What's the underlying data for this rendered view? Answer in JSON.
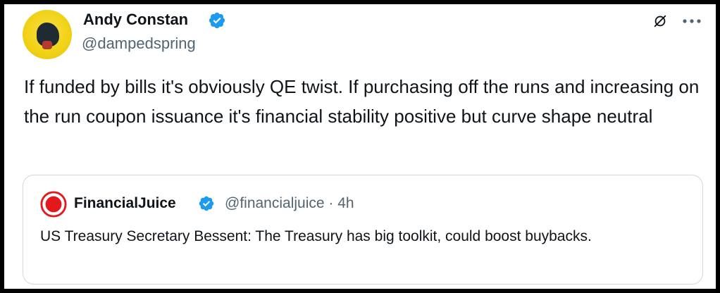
{
  "author": {
    "name": "Andy Constan",
    "handle": "@dampedspring",
    "verified": true
  },
  "tweet": {
    "text": "If funded by bills it's obviously QE twist.  If purchasing off the runs and increasing on the run coupon issuance it's financial stability positive but curve shape neutral"
  },
  "quoted_tweet": {
    "name": "FinancialJuice",
    "handle": "@financialjuice",
    "separator": "·",
    "time": "4h",
    "verified": true,
    "text": "US Treasury Secretary Bessent: The Treasury has big toolkit, could boost buybacks."
  },
  "icons": {
    "verified": "verified-badge-icon",
    "grok": "grok-icon",
    "more": "more-options-icon",
    "quote_avatar": "financialjuice-logo-icon"
  },
  "colors": {
    "text": "#0f1419",
    "secondary": "#536471",
    "verified": "#1d9bf0",
    "border": "#cfd9de",
    "quote_logo": "#e3181c"
  }
}
